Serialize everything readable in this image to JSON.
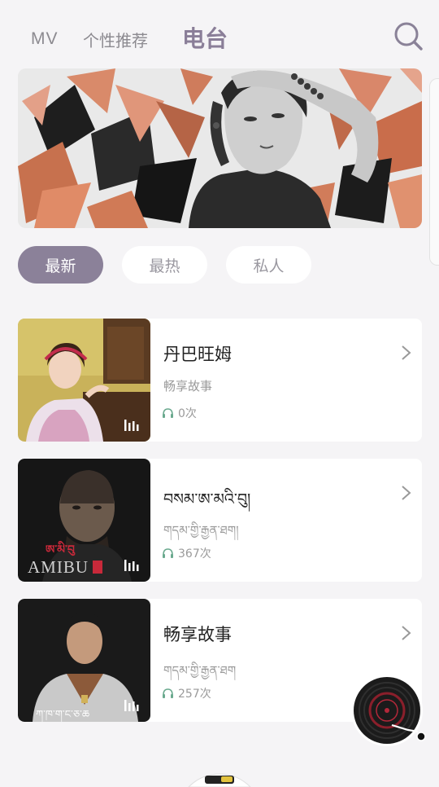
{
  "nav": {
    "tabs": [
      {
        "label": "MV"
      },
      {
        "label": "个性推荐"
      },
      {
        "label": "电台"
      }
    ],
    "active_tab": "电台"
  },
  "filters": [
    {
      "label": "最新",
      "active": true
    },
    {
      "label": "最热",
      "active": false
    },
    {
      "label": "私人",
      "active": false
    }
  ],
  "cards": [
    {
      "title": "丹巴旺姆",
      "subtitle": "畅享故事",
      "plays": "0次"
    },
    {
      "title": "བསམ་ཨ་མའི་བུ།",
      "subtitle": "གདམ་གྱི་རྒྱན་ཐག།",
      "plays": "367次",
      "thumb_caption": "AMIBU"
    },
    {
      "title": "畅享故事",
      "subtitle": "གདམ་གྱི་རྒྱན་ཐག",
      "plays": "257次"
    }
  ],
  "colors": {
    "accent": "#8b8199",
    "background": "#f5f4f6",
    "headphone": "#6aa98e"
  },
  "icons": {
    "search": "search-icon",
    "chevron": "chevron-right-icon",
    "plays": "headphones-icon",
    "equalizer": "equalizer-bars-icon",
    "player": "vinyl-record-icon"
  }
}
